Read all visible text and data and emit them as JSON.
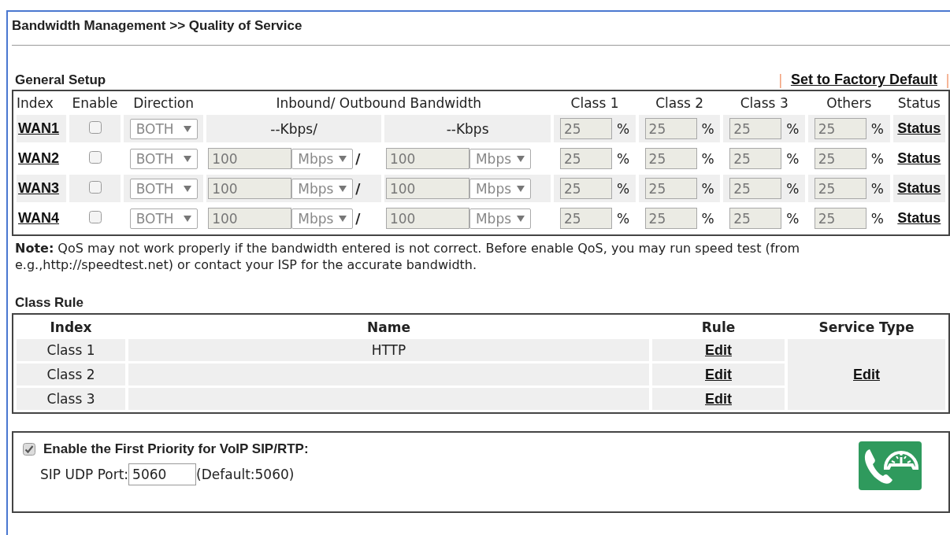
{
  "page_title": "Bandwidth Management >> Quality of Service",
  "general_setup": {
    "title": "General Setup",
    "separator_left": "|",
    "factory_default_link": "Set to Factory Default",
    "separator_right": "|",
    "columns": [
      "Index",
      "Enable",
      "Direction",
      "Inbound/ Outbound Bandwidth",
      "Class 1",
      "Class 2",
      "Class 3",
      "Others",
      "Status"
    ],
    "rows": [
      {
        "index": "WAN1",
        "enabled": false,
        "direction": "BOTH",
        "bandwidth": {
          "kind": "text",
          "inbound": "--Kbps/",
          "outbound": "--Kbps"
        },
        "classes": [
          {
            "value": "25",
            "unit": "%"
          },
          {
            "value": "25",
            "unit": "%"
          },
          {
            "value": "25",
            "unit": "%"
          },
          {
            "value": "25",
            "unit": "%"
          }
        ],
        "status": "Status"
      },
      {
        "index": "WAN2",
        "enabled": false,
        "direction": "BOTH",
        "bandwidth": {
          "kind": "fields",
          "inbound": {
            "value": "100",
            "unit": "Mbps"
          },
          "separator": "/",
          "outbound": {
            "value": "100",
            "unit": "Mbps"
          }
        },
        "classes": [
          {
            "value": "25",
            "unit": "%"
          },
          {
            "value": "25",
            "unit": "%"
          },
          {
            "value": "25",
            "unit": "%"
          },
          {
            "value": "25",
            "unit": "%"
          }
        ],
        "status": "Status"
      },
      {
        "index": "WAN3",
        "enabled": false,
        "direction": "BOTH",
        "bandwidth": {
          "kind": "fields",
          "inbound": {
            "value": "100",
            "unit": "Mbps"
          },
          "separator": "/",
          "outbound": {
            "value": "100",
            "unit": "Mbps"
          }
        },
        "classes": [
          {
            "value": "25",
            "unit": "%"
          },
          {
            "value": "25",
            "unit": "%"
          },
          {
            "value": "25",
            "unit": "%"
          },
          {
            "value": "25",
            "unit": "%"
          }
        ],
        "status": "Status"
      },
      {
        "index": "WAN4",
        "enabled": false,
        "direction": "BOTH",
        "bandwidth": {
          "kind": "fields",
          "inbound": {
            "value": "100",
            "unit": "Mbps"
          },
          "separator": "/",
          "outbound": {
            "value": "100",
            "unit": "Mbps"
          }
        },
        "classes": [
          {
            "value": "25",
            "unit": "%"
          },
          {
            "value": "25",
            "unit": "%"
          },
          {
            "value": "25",
            "unit": "%"
          },
          {
            "value": "25",
            "unit": "%"
          }
        ],
        "status": "Status"
      }
    ],
    "note": "**Note:** QoS may not work properly if the bandwidth entered is not correct. Before enable QoS, you may run speed test (from e.g.,http://speedtest.net) or contact your ISP for the accurate bandwidth."
  },
  "class_rule": {
    "title": "Class Rule",
    "columns": [
      "Index",
      "Name",
      "Rule",
      "Service Type"
    ],
    "rows": [
      {
        "index": "Class 1",
        "name": "HTTP",
        "rule": "Edit"
      },
      {
        "index": "Class 2",
        "rule": "Edit"
      },
      {
        "index": "Class 3",
        "rule": "Edit"
      }
    ],
    "service_type_link": "Edit"
  },
  "voip": {
    "checked": true,
    "label": "Enable the First Priority for VoIP SIP/RTP:",
    "port_label": "SIP UDP Port:",
    "port_value": "5060",
    "default_hint": "(Default:5060)"
  }
}
